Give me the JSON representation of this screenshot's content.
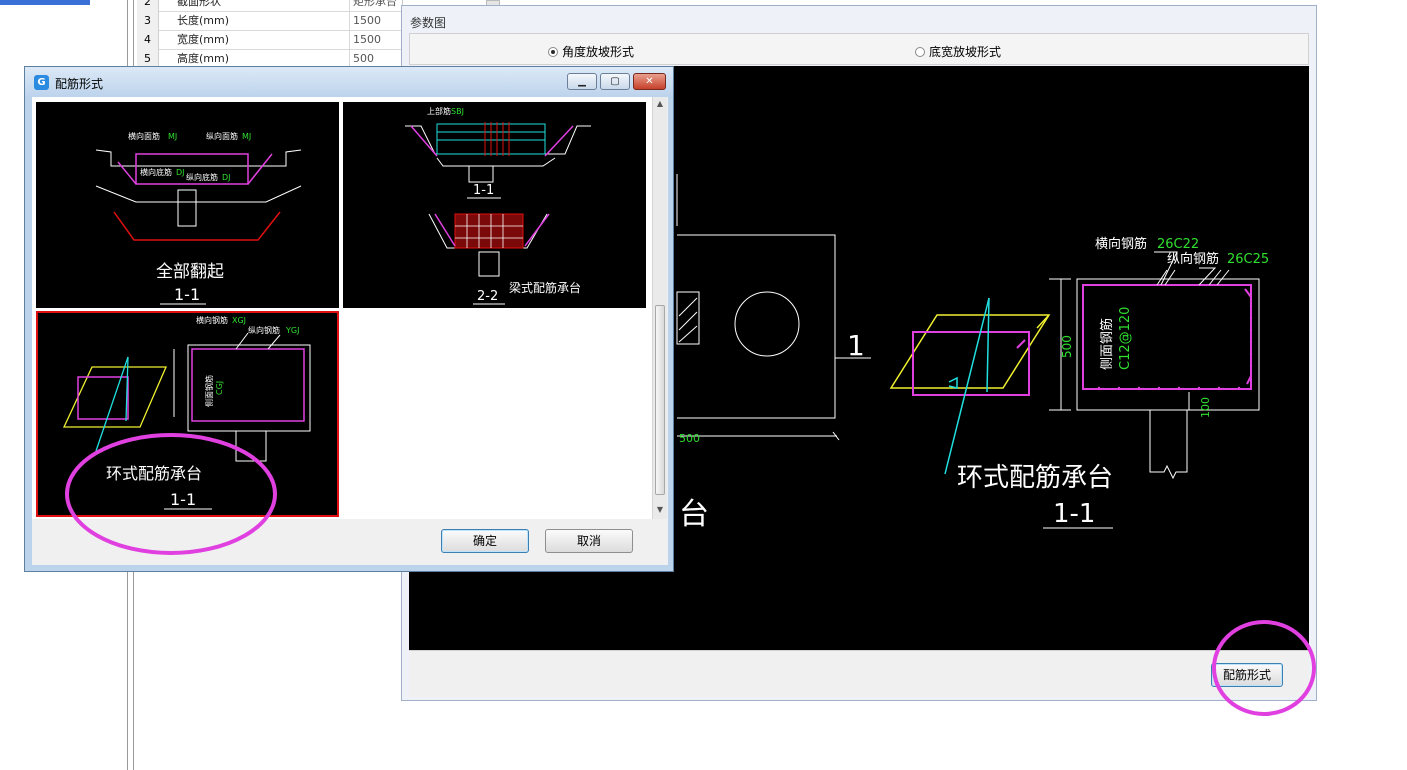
{
  "property_grid": {
    "rows": [
      {
        "num": "2",
        "name": "截面形状",
        "value": "矩形承台"
      },
      {
        "num": "3",
        "name": "长度(mm)",
        "value": "1500"
      },
      {
        "num": "4",
        "name": "宽度(mm)",
        "value": "1500"
      },
      {
        "num": "5",
        "name": "高度(mm)",
        "value": "500"
      }
    ]
  },
  "param_window": {
    "title": "参数图",
    "radio_angle": "角度放坡形式",
    "radio_width": "底宽放坡形式",
    "selected_radio": "角度放坡形式",
    "rebar_button": "配筋形式",
    "drawing": {
      "title": "环式配筋承台",
      "section": "1-1",
      "left_partial_title": "台",
      "left_section_mark": "1",
      "left_dim": "500",
      "transverse_label": "横向钢筋",
      "transverse_value": "26C22",
      "longitudinal_label": "纵向钢筋",
      "longitudinal_value": "26C25",
      "side_label": "侧面钢筋",
      "side_value": "C12@120",
      "height_dim": "500",
      "pile_dim": "100"
    }
  },
  "dialog": {
    "title": "配筋形式",
    "ok": "确定",
    "cancel": "取消",
    "thumbnails": [
      {
        "caption": "全部翻起",
        "section": "1-1",
        "selected": false
      },
      {
        "caption": "梁式配筋承台",
        "section_top": "1-1",
        "section": "2-2",
        "selected": false
      },
      {
        "caption": "环式配筋承台",
        "section": "1-1",
        "selected": true
      }
    ]
  },
  "colors": {
    "canvas_bg": "#000000",
    "highlight_circle": "#e040e0",
    "selection_border": "#e01010",
    "rebar_magenta": "#e040e0",
    "dim_green": "#30e030",
    "cyan": "#20e0e0",
    "yellow": "#f0f030"
  }
}
